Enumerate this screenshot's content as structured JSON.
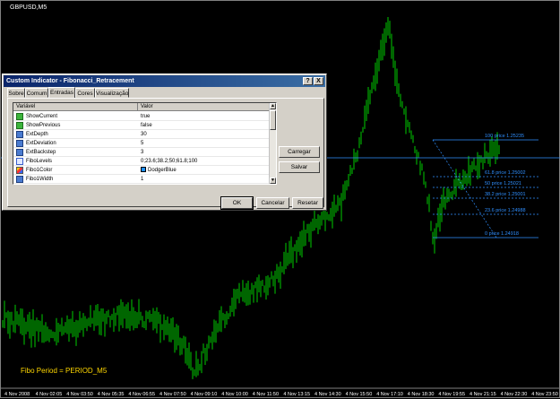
{
  "chart": {
    "symbol": "GBPUSD,M5",
    "indicator_label": "Fibo Period = PERIOD_M5",
    "x_labels": [
      "4 Nov 2008",
      "4 Nov 02:05",
      "4 Nov 03:50",
      "4 Nov 05:35",
      "4 Nov 06:55",
      "4 Nov 07:50",
      "4 Nov 09:10",
      "4 Nov 10:00",
      "4 Nov 11:50",
      "4 Nov 13:15",
      "4 Nov 14:30",
      "4 Nov 15:50",
      "4 Nov 17:10",
      "4 Nov 18:30",
      "4 Nov 19:55",
      "4 Nov 21:15",
      "4 Nov 22:30",
      "4 Nov 23:50"
    ],
    "fibo_levels": [
      {
        "label": "100 price 1.25235"
      },
      {
        "label": "61.8 price 1.25002"
      },
      {
        "label": "50 price 1.25021"
      },
      {
        "label": "38.2 price 1.25001"
      },
      {
        "label": "23.6 price 1.24988"
      },
      {
        "label": "0 price 1.24918"
      }
    ],
    "colors": {
      "background": "#000000",
      "bars": "#00cc00",
      "fibo": "#2f8fff",
      "fibo_text": "#2f8fff",
      "indicator_text": "#ffd700"
    }
  },
  "dialog": {
    "title": "Custom Indicator - Fibonacci_Retracement",
    "help_button": "?",
    "close_button": "X",
    "tabs": [
      {
        "label": "Sobre"
      },
      {
        "label": "Comum"
      },
      {
        "label": "Entradas",
        "active": true
      },
      {
        "label": "Cores"
      },
      {
        "label": "Visualização"
      }
    ],
    "columns": {
      "variable": "Variável",
      "value": "Valor"
    },
    "rows": [
      {
        "name": "ShowCurrent",
        "value": "true",
        "icon": "bool"
      },
      {
        "name": "ShowPrevious",
        "value": "false",
        "icon": "bool"
      },
      {
        "name": "ExtDepth",
        "value": "30",
        "icon": "int"
      },
      {
        "name": "ExtDeviation",
        "value": "5",
        "icon": "int"
      },
      {
        "name": "ExtBackstep",
        "value": "3",
        "icon": "int"
      },
      {
        "name": "FiboLevels",
        "value": "0;23.6;38.2;50;61.8;100",
        "icon": "text"
      },
      {
        "name": "Fibo1Color",
        "value": "DodgerBlue",
        "icon": "color",
        "color": "#1e90ff"
      },
      {
        "name": "Fibo1Width",
        "value": "1",
        "icon": "int"
      },
      {
        "name": "Fibo1Style",
        "value": "2",
        "icon": "int"
      }
    ],
    "buttons": {
      "load": "Carregar",
      "save": "Salvar",
      "ok": "OK",
      "cancel": "Cancelar",
      "reset": "Resetar"
    }
  }
}
